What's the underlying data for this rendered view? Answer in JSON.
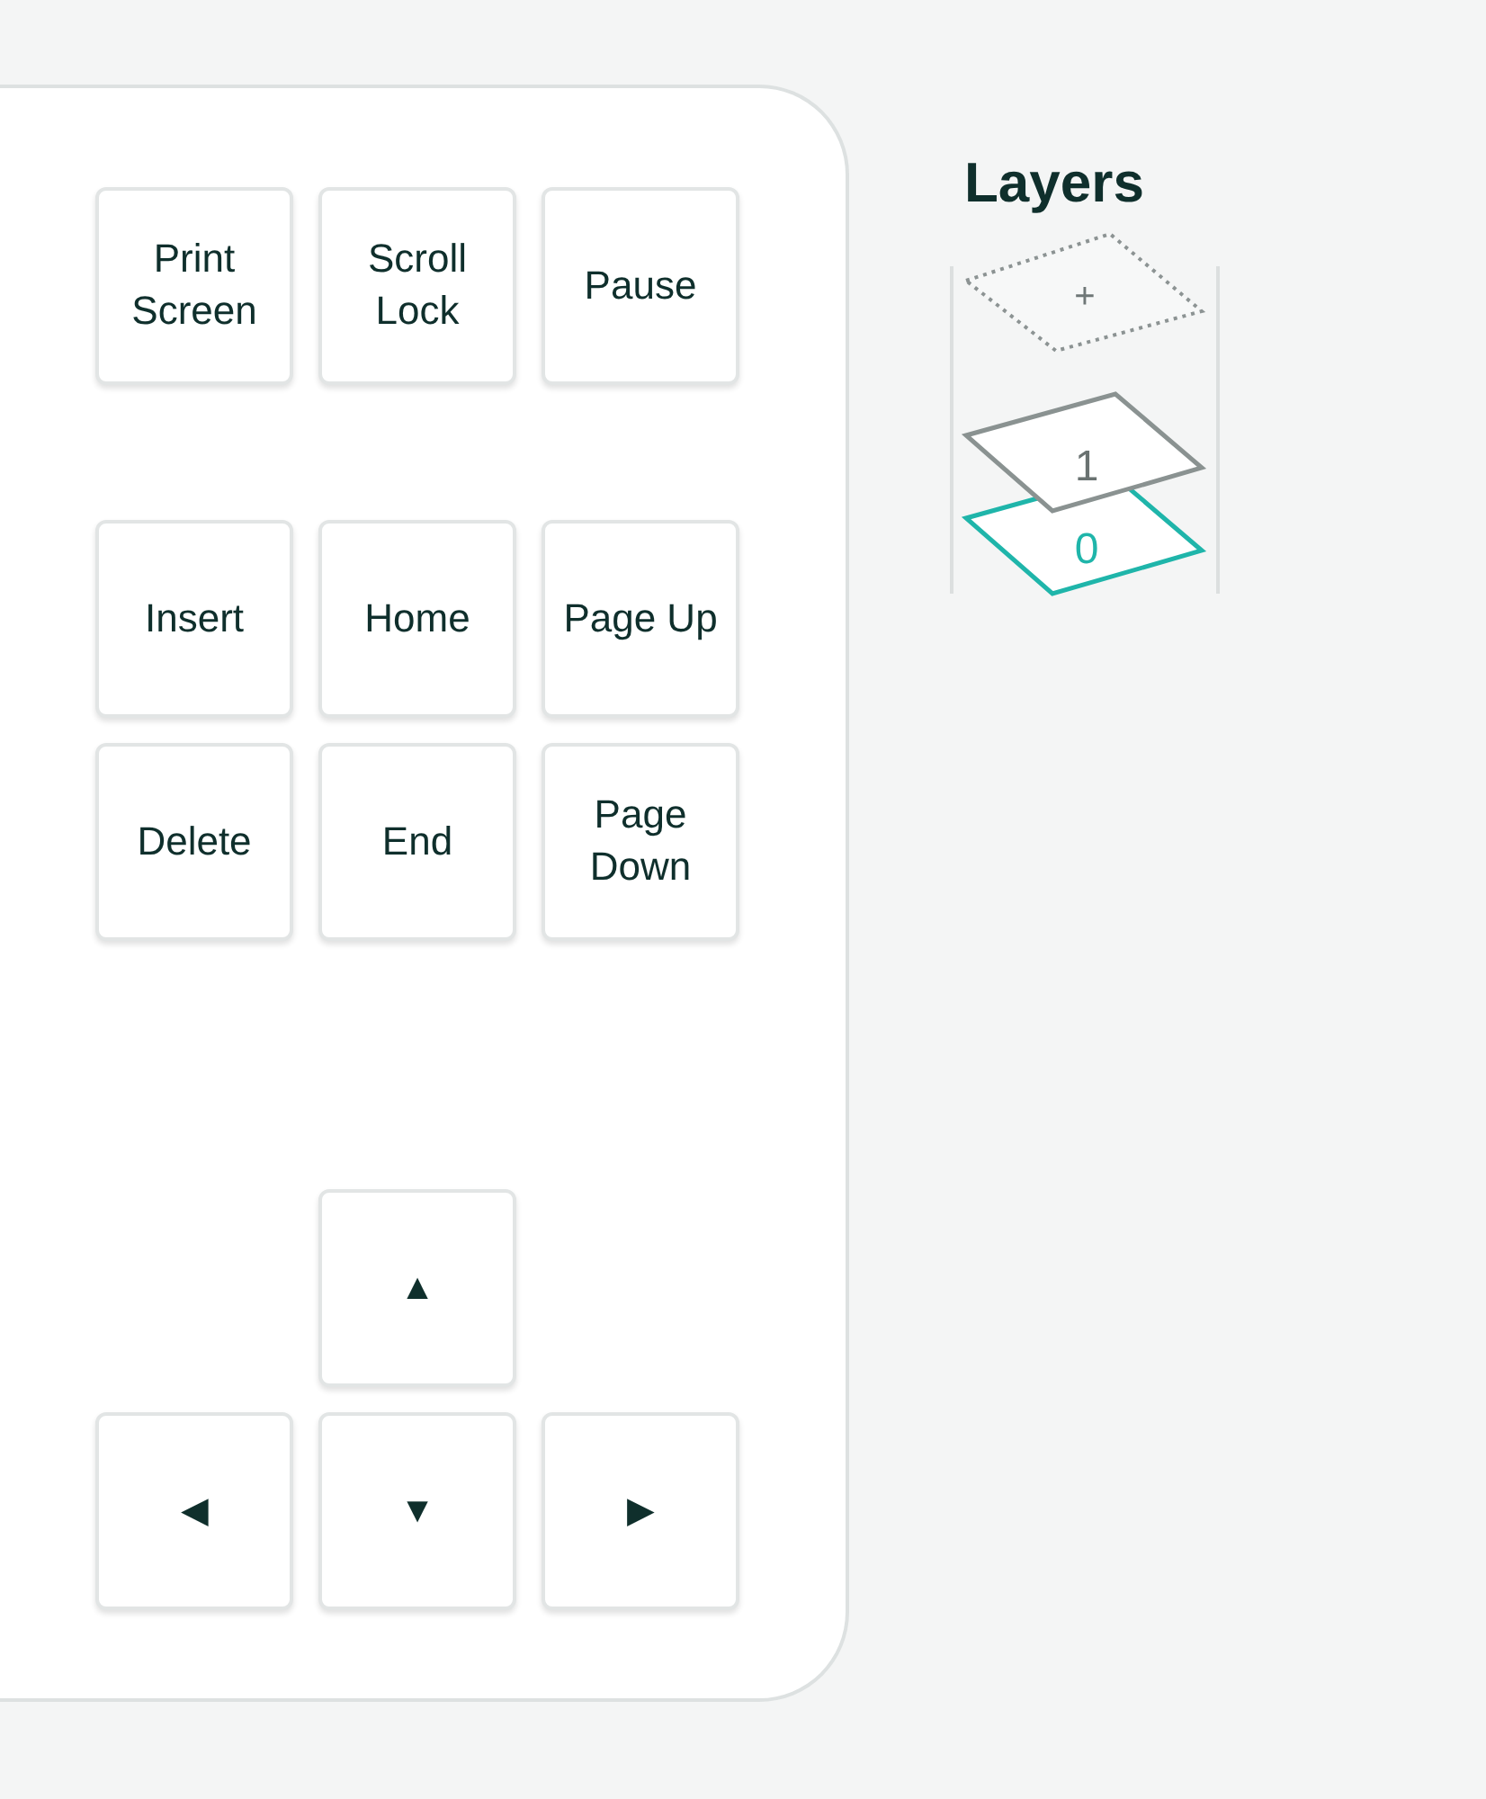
{
  "key_clusters": [
    {
      "keys": [
        {
          "kind": "key",
          "label": "Print Screen"
        },
        {
          "kind": "key",
          "label": "Scroll Lock"
        },
        {
          "kind": "key",
          "label": "Pause"
        }
      ]
    },
    {
      "keys": [
        {
          "kind": "key",
          "label": "Insert"
        },
        {
          "kind": "key",
          "label": "Home"
        },
        {
          "kind": "key",
          "label": "Page Up"
        },
        {
          "kind": "key",
          "label": "Delete"
        },
        {
          "kind": "key",
          "label": "End"
        },
        {
          "kind": "key",
          "label": "Page Down"
        }
      ]
    },
    {
      "keys": [
        {
          "kind": "gap"
        },
        {
          "kind": "arrow",
          "label": "▲"
        },
        {
          "kind": "gap"
        },
        {
          "kind": "arrow",
          "label": "◀"
        },
        {
          "kind": "arrow",
          "label": "▼"
        },
        {
          "kind": "arrow",
          "label": "▶"
        }
      ]
    }
  ],
  "layers": {
    "title": "Layers",
    "items": [
      {
        "kind": "add",
        "label": "+"
      },
      {
        "kind": "layer",
        "label": "1",
        "selected": false
      },
      {
        "kind": "layer",
        "label": "0",
        "selected": true
      }
    ]
  }
}
